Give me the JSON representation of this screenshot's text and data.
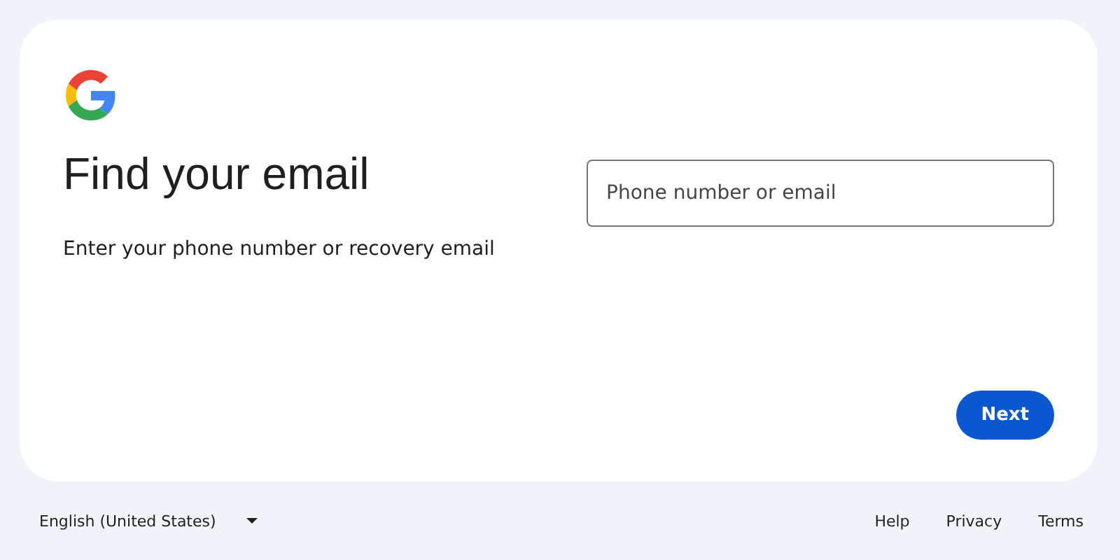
{
  "card": {
    "title": "Find your email",
    "subtitle": "Enter your phone number or recovery email",
    "field": {
      "placeholder": "Phone number or email"
    },
    "buttons": [
      {
        "label": "Next"
      }
    ]
  },
  "footer": {
    "language": "English (United States)",
    "links": [
      "Help",
      "Privacy",
      "Terms"
    ]
  }
}
